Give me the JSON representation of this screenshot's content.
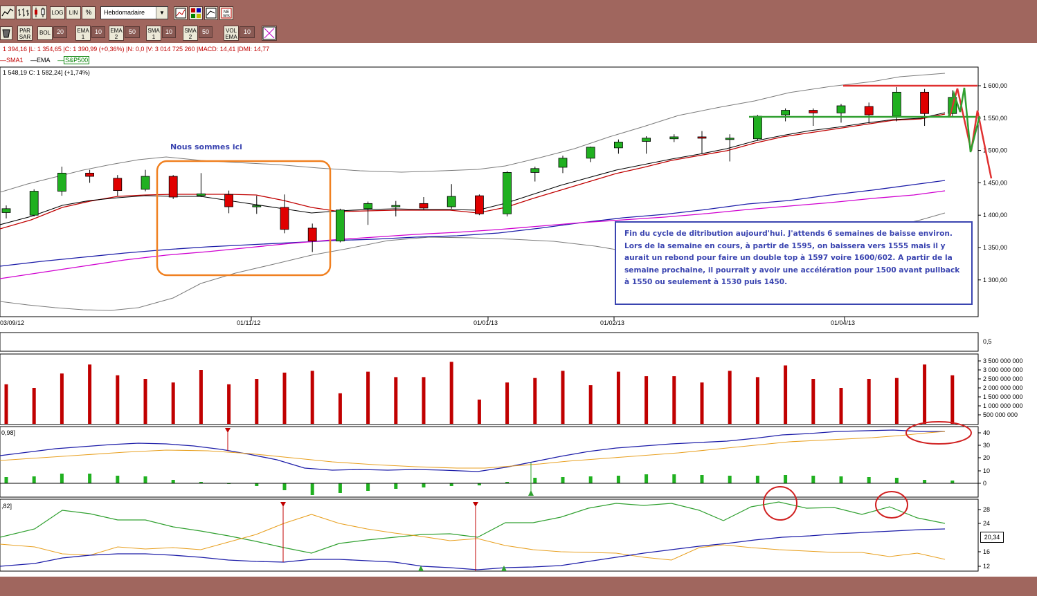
{
  "toolbar1": {
    "buttons": [
      {
        "name": "line-chart-icon",
        "label": ""
      },
      {
        "name": "bar-chart-icon",
        "label": ""
      },
      {
        "name": "candlestick-icon",
        "label": ""
      },
      {
        "name": "log-button",
        "label": "LOG"
      },
      {
        "name": "lin-button",
        "label": "LIN"
      },
      {
        "name": "percent-button",
        "label": "%"
      }
    ],
    "period_select": "Hebdomadaire",
    "right_icons": [
      "chart-type-icon",
      "palette-icon",
      "compare-icon",
      "news-icon"
    ]
  },
  "toolbar2": {
    "items": [
      {
        "label": "PAR SAR",
        "value": ""
      },
      {
        "label": "BOL",
        "value": "20"
      },
      {
        "label": "EMA 1",
        "value": "10"
      },
      {
        "label": "EMA 2",
        "value": "50"
      },
      {
        "label": "SMA 1",
        "value": "10"
      },
      {
        "label": "SMA 2",
        "value": "50"
      },
      {
        "label": "VOL EMA",
        "value": "10"
      }
    ],
    "news_label": "NE WS"
  },
  "info_line": "1 394,16 |L: 1 354,65 |C: 1 390,99 (+0,36%) |N: 0,0 |V: 3 014 725 260 |MACD: 14,41 |DMI: 14,77",
  "legend": {
    "sma1": "SMA1",
    "ema": "EMA",
    "sp": "S&P500",
    "colors": {
      "sma1": "#c00000",
      "ema": "#000000",
      "sp": "#008000"
    }
  },
  "sub_info": "1 548,19  C: 1 582,24] (+1,74%)",
  "annotation_label": "Nous sommes ici",
  "note": "Fin du cycle de ditribution aujourd'hui. J'attends 6 semaines de baisse environ. Lors de la semaine en cours, à partir de 1595, on baissera vers 1555 mais il y aurait un rebond pour faire un double top à 1597 voire 1600/602. A partir de la semaine prochaine, il pourrait y avoir une accélération pour 1500 avant pullback  à 1550 ou seulement à 1530 puis 1450.",
  "x_labels": [
    "03/09/12",
    "01/11/12",
    "01/01/13",
    "01/02/13",
    "01/04/13"
  ],
  "price_ticks": [
    "1 600,00",
    "1 550,00",
    "1 500,00",
    "1 450,00",
    "1 400,00",
    "1 350,00",
    "1 300,00"
  ],
  "panel2_ticks": [
    "0,5"
  ],
  "volume_ticks": [
    "3 500 000 000",
    "3 000 000 000",
    "2 500 000 000",
    "2 000 000 000",
    "1 500 000 000",
    "1 000 000 000",
    "500 000 000"
  ],
  "macd_label": "0,98]",
  "macd_ticks": [
    "40",
    "30",
    "20",
    "10",
    "0"
  ],
  "dmi_label": ",82]",
  "dmi_ticks": [
    "28",
    "24",
    "16",
    "12"
  ],
  "dmi_value": "20,34",
  "chart_data": {
    "type": "candlestick",
    "candles": [
      {
        "o": 1404,
        "c": 1410,
        "h": 1415,
        "l": 1395
      },
      {
        "o": 1400,
        "c": 1437,
        "h": 1440,
        "l": 1398
      },
      {
        "o": 1437,
        "c": 1465,
        "h": 1475,
        "l": 1430
      },
      {
        "o": 1465,
        "c": 1460,
        "h": 1470,
        "l": 1450
      },
      {
        "o": 1457,
        "c": 1438,
        "h": 1462,
        "l": 1430
      },
      {
        "o": 1440,
        "c": 1460,
        "h": 1470,
        "l": 1437
      },
      {
        "o": 1460,
        "c": 1428,
        "h": 1462,
        "l": 1425
      },
      {
        "o": 1430,
        "c": 1433,
        "h": 1465,
        "l": 1428
      },
      {
        "o": 1432,
        "c": 1413,
        "h": 1438,
        "l": 1403
      },
      {
        "o": 1414,
        "c": 1415,
        "h": 1430,
        "l": 1402
      },
      {
        "o": 1412,
        "c": 1378,
        "h": 1432,
        "l": 1372
      },
      {
        "o": 1380,
        "c": 1360,
        "h": 1387,
        "l": 1343
      },
      {
        "o": 1360,
        "c": 1408,
        "h": 1410,
        "l": 1358
      },
      {
        "o": 1410,
        "c": 1418,
        "h": 1421,
        "l": 1385
      },
      {
        "o": 1414,
        "c": 1415,
        "h": 1422,
        "l": 1398
      },
      {
        "o": 1418,
        "c": 1411,
        "h": 1428,
        "l": 1408
      },
      {
        "o": 1413,
        "c": 1429,
        "h": 1448,
        "l": 1410
      },
      {
        "o": 1430,
        "c": 1402,
        "h": 1432,
        "l": 1400
      },
      {
        "o": 1402,
        "c": 1466,
        "h": 1468,
        "l": 1398
      },
      {
        "o": 1466,
        "c": 1472,
        "h": 1475,
        "l": 1452
      },
      {
        "o": 1474,
        "c": 1488,
        "h": 1492,
        "l": 1465
      },
      {
        "o": 1488,
        "c": 1505,
        "h": 1506,
        "l": 1482
      },
      {
        "o": 1504,
        "c": 1513,
        "h": 1517,
        "l": 1495
      },
      {
        "o": 1514,
        "c": 1519,
        "h": 1522,
        "l": 1495
      },
      {
        "o": 1518,
        "c": 1521,
        "h": 1525,
        "l": 1513
      },
      {
        "o": 1521,
        "c": 1520,
        "h": 1530,
        "l": 1495
      },
      {
        "o": 1518,
        "c": 1519,
        "h": 1525,
        "l": 1483
      },
      {
        "o": 1518,
        "c": 1553,
        "h": 1555,
        "l": 1515
      },
      {
        "o": 1555,
        "c": 1562,
        "h": 1565,
        "l": 1545
      },
      {
        "o": 1562,
        "c": 1558,
        "h": 1565,
        "l": 1538
      },
      {
        "o": 1558,
        "c": 1569,
        "h": 1572,
        "l": 1543
      },
      {
        "o": 1568,
        "c": 1555,
        "h": 1574,
        "l": 1542
      },
      {
        "o": 1553,
        "c": 1590,
        "h": 1598,
        "l": 1545
      },
      {
        "o": 1590,
        "c": 1557,
        "h": 1595,
        "l": 1538
      },
      {
        "o": 1557,
        "c": 1582,
        "h": 1593,
        "l": 1552
      }
    ],
    "volumes": [
      2.2,
      2.0,
      2.8,
      3.3,
      2.7,
      2.5,
      2.3,
      3.0,
      2.2,
      2.5,
      2.85,
      2.95,
      1.7,
      2.9,
      2.6,
      2.6,
      3.45,
      1.35,
      2.3,
      2.55,
      2.95,
      2.15,
      2.9,
      2.65,
      2.65,
      2.3,
      2.95,
      2.6,
      3.25,
      2.5,
      2.0,
      2.5,
      2.55,
      3.3,
      2.7
    ]
  }
}
